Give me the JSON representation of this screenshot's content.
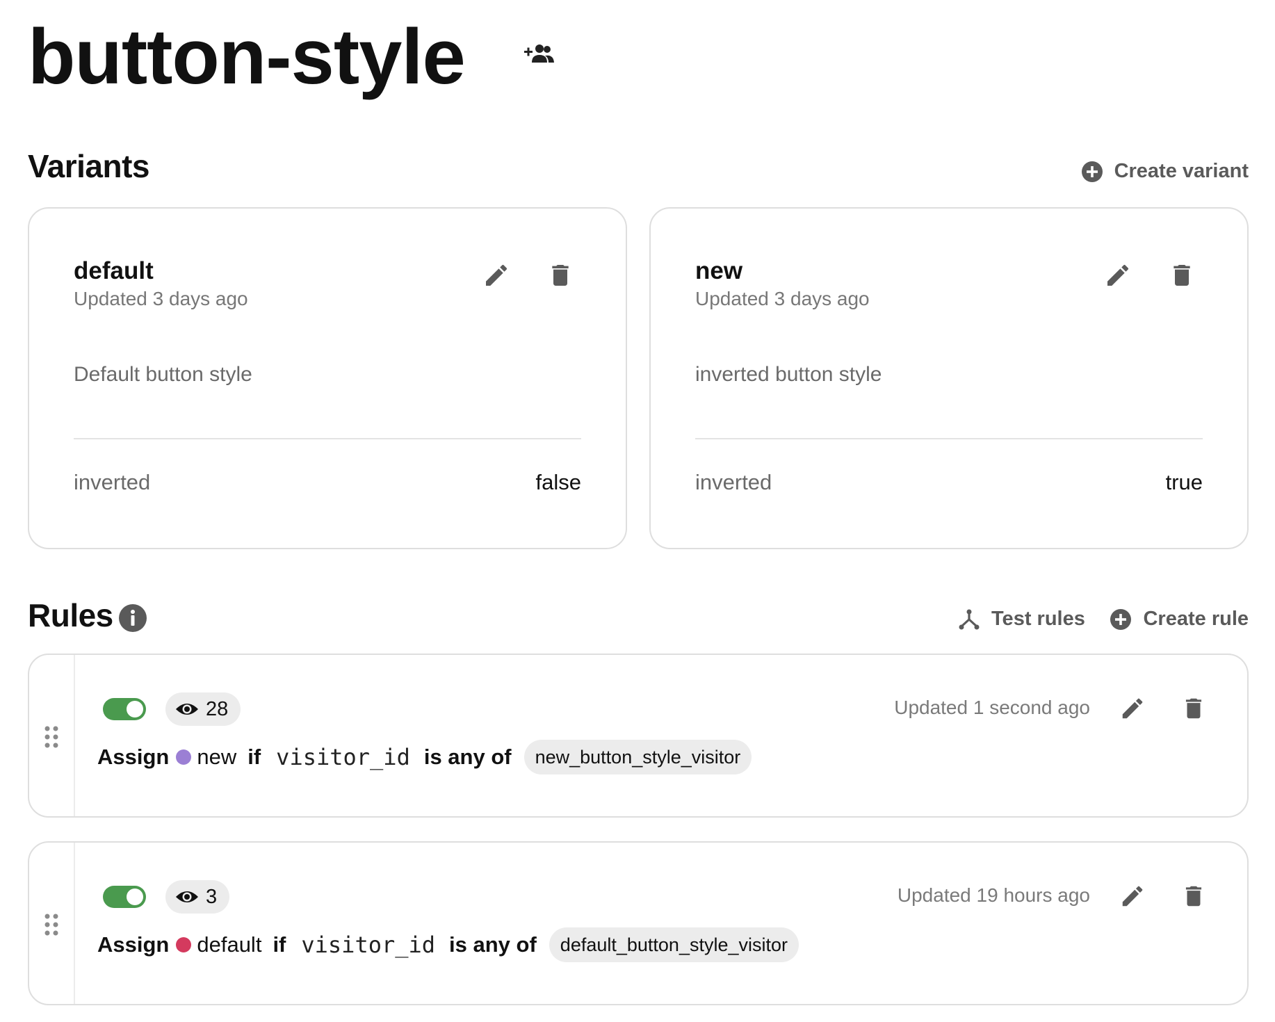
{
  "page": {
    "title": "button-style"
  },
  "variants": {
    "heading": "Variants",
    "create_label": "Create variant",
    "items": [
      {
        "name": "default",
        "updated": "Updated 3 days ago",
        "description": "Default button style",
        "key": "inverted",
        "value": "false"
      },
      {
        "name": "new",
        "updated": "Updated 3 days ago",
        "description": "inverted button style",
        "key": "inverted",
        "value": "true"
      }
    ]
  },
  "rules": {
    "heading": "Rules",
    "test_label": "Test rules",
    "create_label": "Create rule",
    "items": [
      {
        "views": "28",
        "updated": "Updated 1 second ago",
        "assign": "Assign",
        "variant": "new",
        "variant_color": "#9b7fd4",
        "if": "if",
        "attribute": "visitor_id",
        "operator": "is any of",
        "value": "new_button_style_visitor",
        "enabled": true
      },
      {
        "views": "3",
        "updated": "Updated 19 hours ago",
        "assign": "Assign",
        "variant": "default",
        "variant_color": "#d43a5e",
        "if": "if",
        "attribute": "visitor_id",
        "operator": "is any of",
        "value": "default_button_style_visitor",
        "enabled": true
      }
    ]
  },
  "colors": {
    "toggle_on": "#4a9a4e",
    "icon_gray": "#5a5a5a",
    "chip_bg": "#ececec",
    "border": "#dedede"
  }
}
